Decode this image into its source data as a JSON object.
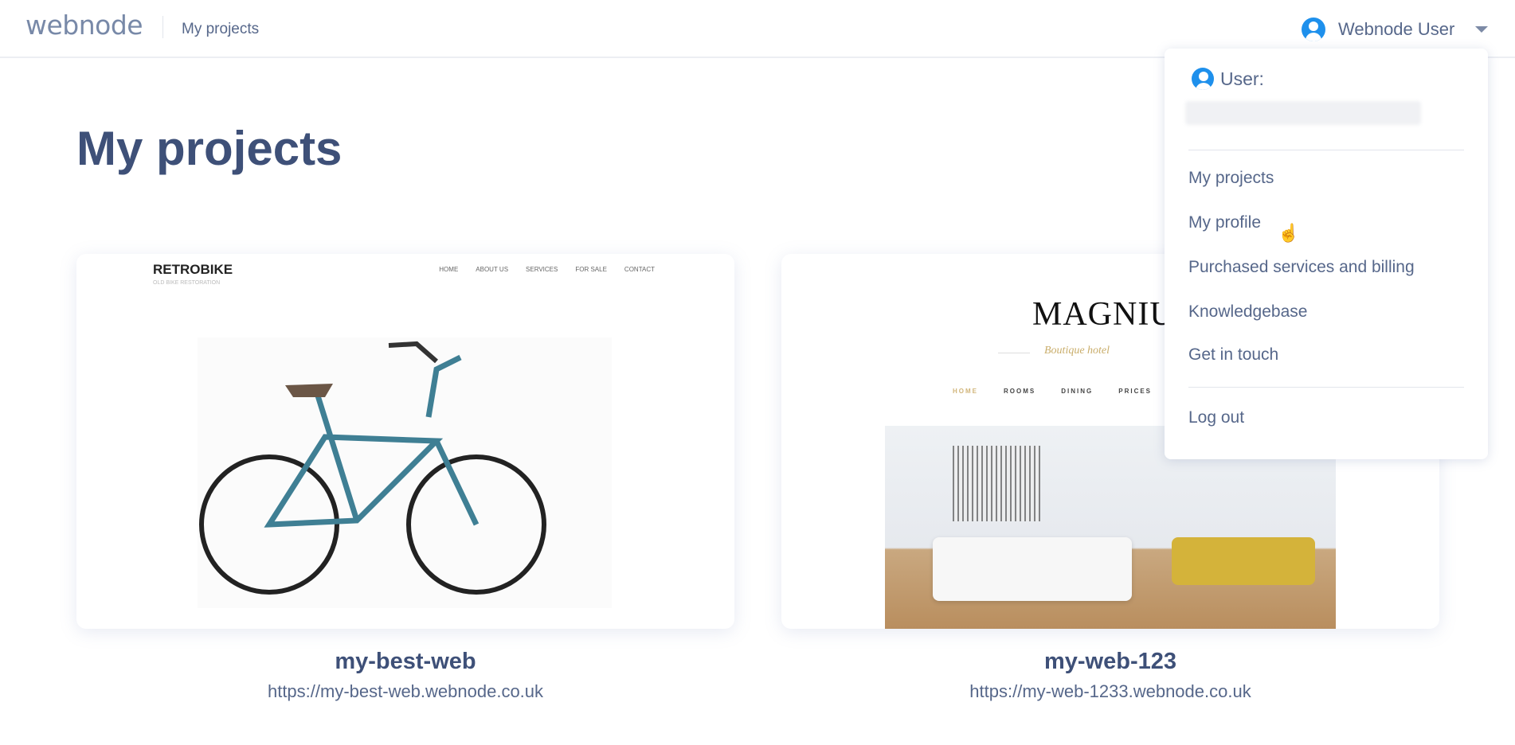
{
  "header": {
    "logo": "webnode",
    "breadcrumb": "My projects",
    "user_name": "Webnode User"
  },
  "page": {
    "title": "My projects"
  },
  "projects": [
    {
      "name": "my-best-web",
      "url": "https://my-best-web.webnode.co.uk",
      "preview": {
        "logo": "RETROBIKE",
        "tagline": "OLD BIKE RESTORATION",
        "nav": [
          "HOME",
          "ABOUT US",
          "SERVICES",
          "FOR SALE",
          "CONTACT"
        ]
      }
    },
    {
      "name": "my-web-123",
      "url": "https://my-web-1233.webnode.co.uk",
      "preview": {
        "logo": "MAGNIU",
        "tagline": "Boutique hotel",
        "nav": [
          "HOME",
          "ROOMS",
          "DINING",
          "PRICES"
        ]
      }
    }
  ],
  "user_menu": {
    "user_label": "User:",
    "items": [
      "My projects",
      "My profile",
      "Purchased services and billing",
      "Knowledgebase",
      "Get in touch"
    ],
    "logout": "Log out"
  },
  "colors": {
    "accent": "#1e90ec",
    "heading": "#3e5078",
    "text": "#56678a"
  }
}
